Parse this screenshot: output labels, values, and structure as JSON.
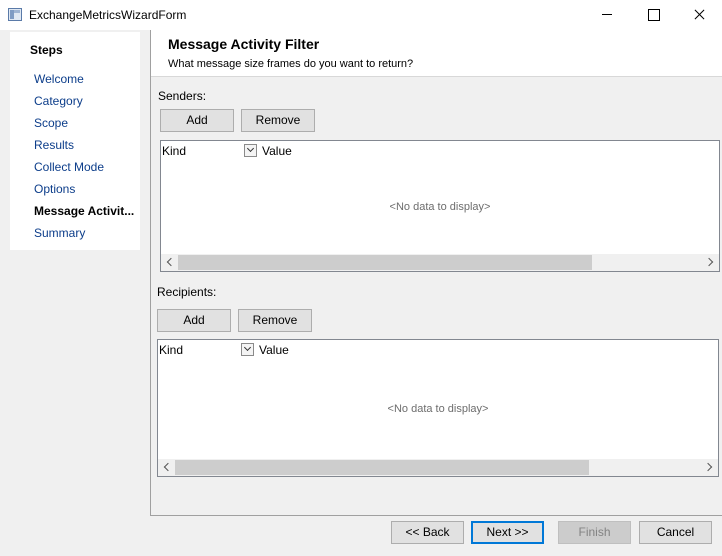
{
  "window": {
    "title": "ExchangeMetricsWizardForm"
  },
  "steps": {
    "heading": "Steps",
    "items": [
      {
        "label": "Welcome",
        "current": false
      },
      {
        "label": "Category",
        "current": false
      },
      {
        "label": "Scope",
        "current": false
      },
      {
        "label": "Results",
        "current": false
      },
      {
        "label": "Collect Mode",
        "current": false
      },
      {
        "label": "Options",
        "current": false
      },
      {
        "label": "Message Activit...",
        "current": true
      },
      {
        "label": "Summary",
        "current": false
      }
    ]
  },
  "header": {
    "title": "Message Activity Filter",
    "subtitle": "What message size frames do you want to return?"
  },
  "senders": {
    "label": "Senders:",
    "add_label": "Add",
    "remove_label": "Remove",
    "columns": {
      "kind": "Kind",
      "value": "Value"
    },
    "empty_text": "<No data to display>"
  },
  "recipients": {
    "label": "Recipients:",
    "add_label": "Add",
    "remove_label": "Remove",
    "columns": {
      "kind": "Kind",
      "value": "Value"
    },
    "empty_text": "<No data to display>"
  },
  "footer": {
    "back_label": "<< Back",
    "next_label": "Next >>",
    "finish_label": "Finish",
    "cancel_label": "Cancel"
  },
  "colors": {
    "link": "#0c3d8a",
    "focus": "#0078d7"
  }
}
